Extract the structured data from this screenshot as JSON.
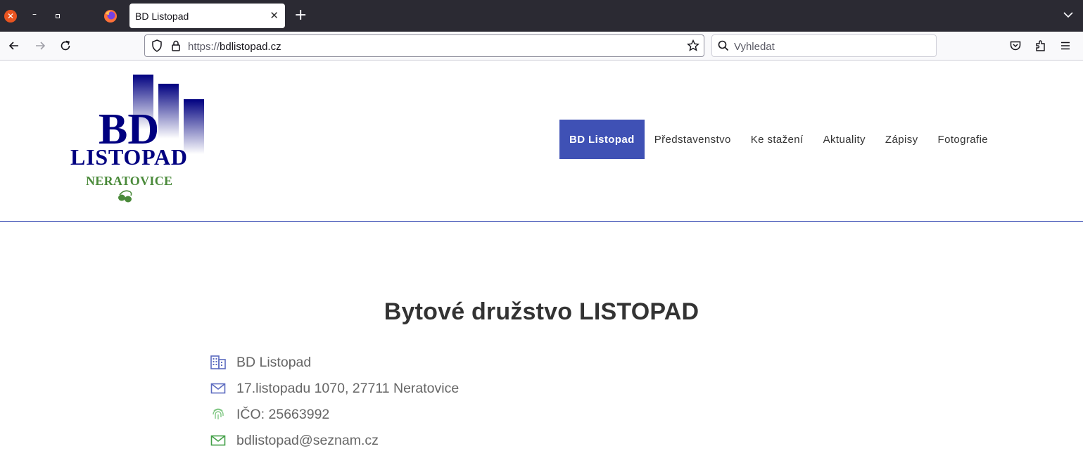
{
  "browser": {
    "tab_title": "BD Listopad",
    "url_scheme": "https://",
    "url_host": "bdlistopad.cz",
    "search_placeholder": "Vyhledat"
  },
  "site": {
    "logo": {
      "line1": "BD",
      "line2": "LISTOPAD",
      "line3": "NERATOVICE"
    },
    "menu": [
      {
        "label": "BD Listopad",
        "active": true
      },
      {
        "label": "Představenstvo"
      },
      {
        "label": "Ke stažení"
      },
      {
        "label": "Aktuality"
      },
      {
        "label": "Zápisy"
      },
      {
        "label": "Fotografie"
      }
    ],
    "colors": {
      "accent": "#3f51b5",
      "logo_blue": "#000080",
      "logo_green": "#4a8a3a"
    }
  },
  "main": {
    "heading": "Bytové družstvo LISTOPAD",
    "info": [
      {
        "icon": "building-icon",
        "text": "BD Listopad"
      },
      {
        "icon": "envelope-icon",
        "text": "17.listopadu 1070, 27711 Neratovice"
      },
      {
        "icon": "fingerprint-icon",
        "text": "IČO: 25663992"
      },
      {
        "icon": "mail-icon",
        "text": "bdlistopad@seznam.cz"
      }
    ]
  }
}
